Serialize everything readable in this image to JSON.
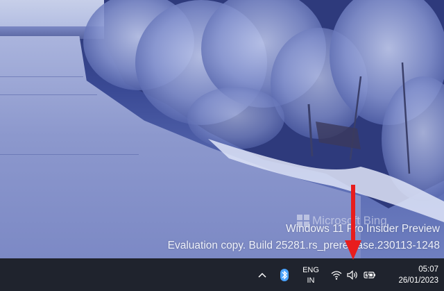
{
  "wallpaper": {
    "bing_label": "Microsoft Bing",
    "watermark_line1": "Windows 11 Pro Insider Preview",
    "watermark_line2": "Evaluation copy. Build 25281.rs_prerelease.230113-1248"
  },
  "taskbar": {
    "icons": {
      "overflow": "chevron-up-icon",
      "bluetooth": "bluetooth-icon",
      "wifi": "wifi-icon",
      "volume": "speaker-volume-icon",
      "battery": "battery-charging-icon"
    },
    "language_line1": "ENG",
    "language_line2": "IN",
    "time": "05:07",
    "date": "26/01/2023",
    "colors": {
      "background": "#1f232d",
      "bluetooth_accent": "#4aa3ff"
    }
  },
  "annotation": {
    "arrow_color": "#e81d1d",
    "pointing_to": "speaker-volume-icon"
  }
}
